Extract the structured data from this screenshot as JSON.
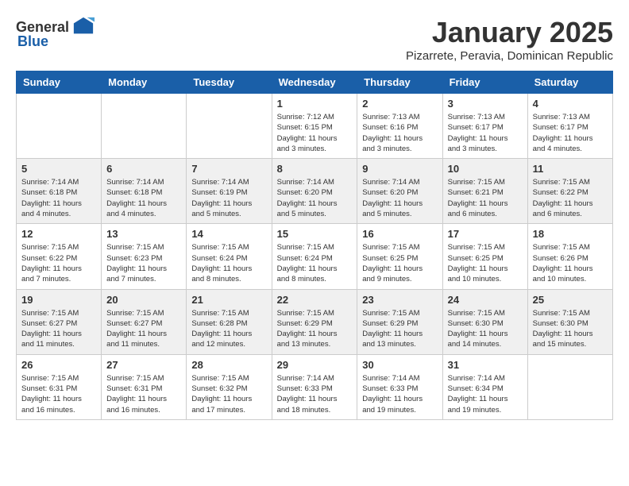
{
  "logo": {
    "text_general": "General",
    "text_blue": "Blue"
  },
  "title": "January 2025",
  "location": "Pizarrete, Peravia, Dominican Republic",
  "headers": [
    "Sunday",
    "Monday",
    "Tuesday",
    "Wednesday",
    "Thursday",
    "Friday",
    "Saturday"
  ],
  "weeks": [
    [
      {
        "day": "",
        "info": ""
      },
      {
        "day": "",
        "info": ""
      },
      {
        "day": "",
        "info": ""
      },
      {
        "day": "1",
        "info": "Sunrise: 7:12 AM\nSunset: 6:15 PM\nDaylight: 11 hours\nand 3 minutes."
      },
      {
        "day": "2",
        "info": "Sunrise: 7:13 AM\nSunset: 6:16 PM\nDaylight: 11 hours\nand 3 minutes."
      },
      {
        "day": "3",
        "info": "Sunrise: 7:13 AM\nSunset: 6:17 PM\nDaylight: 11 hours\nand 3 minutes."
      },
      {
        "day": "4",
        "info": "Sunrise: 7:13 AM\nSunset: 6:17 PM\nDaylight: 11 hours\nand 4 minutes."
      }
    ],
    [
      {
        "day": "5",
        "info": "Sunrise: 7:14 AM\nSunset: 6:18 PM\nDaylight: 11 hours\nand 4 minutes."
      },
      {
        "day": "6",
        "info": "Sunrise: 7:14 AM\nSunset: 6:18 PM\nDaylight: 11 hours\nand 4 minutes."
      },
      {
        "day": "7",
        "info": "Sunrise: 7:14 AM\nSunset: 6:19 PM\nDaylight: 11 hours\nand 5 minutes."
      },
      {
        "day": "8",
        "info": "Sunrise: 7:14 AM\nSunset: 6:20 PM\nDaylight: 11 hours\nand 5 minutes."
      },
      {
        "day": "9",
        "info": "Sunrise: 7:14 AM\nSunset: 6:20 PM\nDaylight: 11 hours\nand 5 minutes."
      },
      {
        "day": "10",
        "info": "Sunrise: 7:15 AM\nSunset: 6:21 PM\nDaylight: 11 hours\nand 6 minutes."
      },
      {
        "day": "11",
        "info": "Sunrise: 7:15 AM\nSunset: 6:22 PM\nDaylight: 11 hours\nand 6 minutes."
      }
    ],
    [
      {
        "day": "12",
        "info": "Sunrise: 7:15 AM\nSunset: 6:22 PM\nDaylight: 11 hours\nand 7 minutes."
      },
      {
        "day": "13",
        "info": "Sunrise: 7:15 AM\nSunset: 6:23 PM\nDaylight: 11 hours\nand 7 minutes."
      },
      {
        "day": "14",
        "info": "Sunrise: 7:15 AM\nSunset: 6:24 PM\nDaylight: 11 hours\nand 8 minutes."
      },
      {
        "day": "15",
        "info": "Sunrise: 7:15 AM\nSunset: 6:24 PM\nDaylight: 11 hours\nand 8 minutes."
      },
      {
        "day": "16",
        "info": "Sunrise: 7:15 AM\nSunset: 6:25 PM\nDaylight: 11 hours\nand 9 minutes."
      },
      {
        "day": "17",
        "info": "Sunrise: 7:15 AM\nSunset: 6:25 PM\nDaylight: 11 hours\nand 10 minutes."
      },
      {
        "day": "18",
        "info": "Sunrise: 7:15 AM\nSunset: 6:26 PM\nDaylight: 11 hours\nand 10 minutes."
      }
    ],
    [
      {
        "day": "19",
        "info": "Sunrise: 7:15 AM\nSunset: 6:27 PM\nDaylight: 11 hours\nand 11 minutes."
      },
      {
        "day": "20",
        "info": "Sunrise: 7:15 AM\nSunset: 6:27 PM\nDaylight: 11 hours\nand 11 minutes."
      },
      {
        "day": "21",
        "info": "Sunrise: 7:15 AM\nSunset: 6:28 PM\nDaylight: 11 hours\nand 12 minutes."
      },
      {
        "day": "22",
        "info": "Sunrise: 7:15 AM\nSunset: 6:29 PM\nDaylight: 11 hours\nand 13 minutes."
      },
      {
        "day": "23",
        "info": "Sunrise: 7:15 AM\nSunset: 6:29 PM\nDaylight: 11 hours\nand 13 minutes."
      },
      {
        "day": "24",
        "info": "Sunrise: 7:15 AM\nSunset: 6:30 PM\nDaylight: 11 hours\nand 14 minutes."
      },
      {
        "day": "25",
        "info": "Sunrise: 7:15 AM\nSunset: 6:30 PM\nDaylight: 11 hours\nand 15 minutes."
      }
    ],
    [
      {
        "day": "26",
        "info": "Sunrise: 7:15 AM\nSunset: 6:31 PM\nDaylight: 11 hours\nand 16 minutes."
      },
      {
        "day": "27",
        "info": "Sunrise: 7:15 AM\nSunset: 6:31 PM\nDaylight: 11 hours\nand 16 minutes."
      },
      {
        "day": "28",
        "info": "Sunrise: 7:15 AM\nSunset: 6:32 PM\nDaylight: 11 hours\nand 17 minutes."
      },
      {
        "day": "29",
        "info": "Sunrise: 7:14 AM\nSunset: 6:33 PM\nDaylight: 11 hours\nand 18 minutes."
      },
      {
        "day": "30",
        "info": "Sunrise: 7:14 AM\nSunset: 6:33 PM\nDaylight: 11 hours\nand 19 minutes."
      },
      {
        "day": "31",
        "info": "Sunrise: 7:14 AM\nSunset: 6:34 PM\nDaylight: 11 hours\nand 19 minutes."
      },
      {
        "day": "",
        "info": ""
      }
    ]
  ]
}
